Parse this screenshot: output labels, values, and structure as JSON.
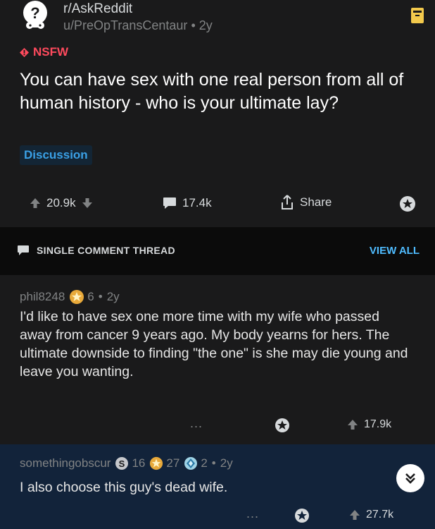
{
  "post": {
    "subreddit": "r/AskReddit",
    "author": "u/PreOpTransCentaur",
    "age": "2y",
    "nsfw_label": "NSFW",
    "title": "You can have sex with one real person from all of human history - who is your ultimate lay?",
    "flair": "Discussion",
    "upvotes": "20.9k",
    "comments": "17.4k",
    "share_label": "Share"
  },
  "thread": {
    "label": "SINGLE COMMENT THREAD",
    "view_all": "VIEW ALL"
  },
  "comment1": {
    "author": "phil8248",
    "award_count": "6",
    "age": "2y",
    "body": "I'd like to have sex one more time with my wife who passed away from cancer 9 years ago.  My body yearns for hers.  The ultimate downside to finding \"the one\" is she may die young and leave you wanting.",
    "more": "...",
    "upvotes": "17.9k"
  },
  "comment2": {
    "author": "somethingobscur",
    "award1_count": "16",
    "award2_count": "27",
    "award3_count": "2",
    "age": "2y",
    "body": "I also choose this guy's dead wife.",
    "more": "...",
    "upvotes": "27.7k"
  },
  "colors": {
    "nsfw": "#ff4a5d",
    "link": "#4fbcff",
    "reply_bg": "#12233a"
  }
}
